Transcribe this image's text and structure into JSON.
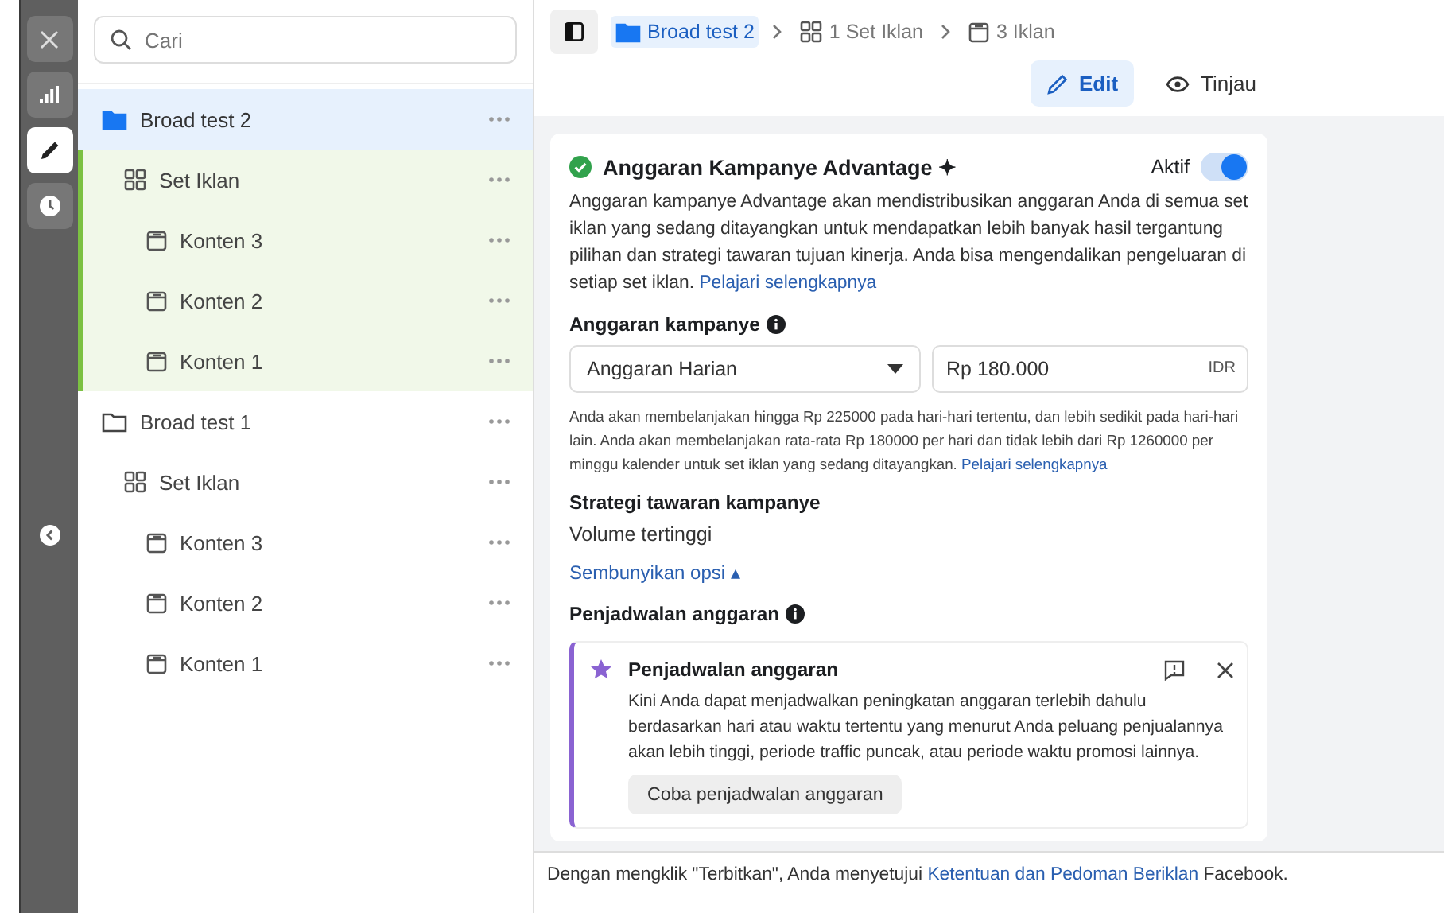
{
  "rail": {
    "buttons": [
      {
        "kind": "close",
        "selected": false
      },
      {
        "kind": "chart",
        "selected": false
      },
      {
        "kind": "edit",
        "selected": true
      },
      {
        "kind": "history",
        "selected": false
      }
    ]
  },
  "search": {
    "placeholder": "Cari"
  },
  "tree": [
    {
      "label": "Broad test 2",
      "kind": "campaign",
      "selected": true,
      "children": [
        {
          "label": "Set Iklan",
          "kind": "adset",
          "selected": false,
          "children": [
            {
              "label": "Konten 3",
              "kind": "ad",
              "selected": false
            },
            {
              "label": "Konten 2",
              "kind": "ad",
              "selected": false
            },
            {
              "label": "Konten 1",
              "kind": "ad",
              "selected": false
            }
          ]
        }
      ]
    },
    {
      "label": "Broad test 1",
      "kind": "campaign",
      "selected": false,
      "children": [
        {
          "label": "Set Iklan",
          "kind": "adset",
          "selected": false,
          "children": [
            {
              "label": "Konten 3",
              "kind": "ad",
              "selected": false
            },
            {
              "label": "Konten 2",
              "kind": "ad",
              "selected": false
            },
            {
              "label": "Konten 1",
              "kind": "ad",
              "selected": false
            }
          ]
        }
      ]
    }
  ],
  "breadcrumbs": [
    {
      "label": "Broad test 2",
      "kind": "campaign",
      "selected": true
    },
    {
      "label": "1 Set Iklan",
      "kind": "adset",
      "selected": false
    },
    {
      "label": "3 Iklan",
      "kind": "ad",
      "selected": false
    }
  ],
  "mode_tabs": [
    {
      "label": "Edit",
      "kind": "edit",
      "selected": true
    },
    {
      "label": "Tinjau",
      "kind": "review",
      "selected": false
    }
  ],
  "card": {
    "title": "Anggaran Kampanye Advantage ✦",
    "toggle": {
      "label": "Aktif",
      "on": true
    },
    "description": "Anggaran kampanye Advantage akan mendistribusikan anggaran Anda di semua set iklan yang sedang ditayangkan untuk mendapatkan lebih banyak hasil tergantung pilihan dan strategi tawaran tujuan kinerja. Anda bisa mengendalikan pengeluaran di setiap set iklan.",
    "description_link": "Pelajari selengkapnya",
    "budget_label": "Anggaran kampanye",
    "budget_type": "Anggaran Harian",
    "budget_amount": "Rp 180.000",
    "currency": "IDR",
    "budget_help": "Anda akan membelanjakan hingga Rp 225000 pada hari-hari tertentu, dan lebih sedikit pada hari-hari lain. Anda akan membelanjakan rata-rata Rp 180000 per hari dan tidak lebih dari Rp 1260000 per minggu kalender untuk set iklan yang sedang ditayangkan.",
    "budget_help_link": "Pelajari selengkapnya",
    "strategy_label": "Strategi tawaran kampanye",
    "strategy_value": "Volume tertinggi",
    "toggle_options": "Sembunyikan opsi ▴",
    "schedule_label": "Penjadwalan anggaran",
    "callout": {
      "title": "Penjadwalan anggaran",
      "body": "Kini Anda dapat menjadwalkan peningkatan anggaran terlebih dahulu berdasarkan hari atau waktu tertentu yang menurut Anda peluang penjualannya akan lebih tinggi, periode traffic puncak, atau periode waktu promosi lainnya.",
      "button": "Coba penjadwalan anggaran"
    }
  },
  "footer": {
    "before": "Dengan mengklik \"Terbitkan\", Anda menyetujui",
    "link": "Ketentuan dan Pedoman Beriklan",
    "after": "Facebook."
  }
}
